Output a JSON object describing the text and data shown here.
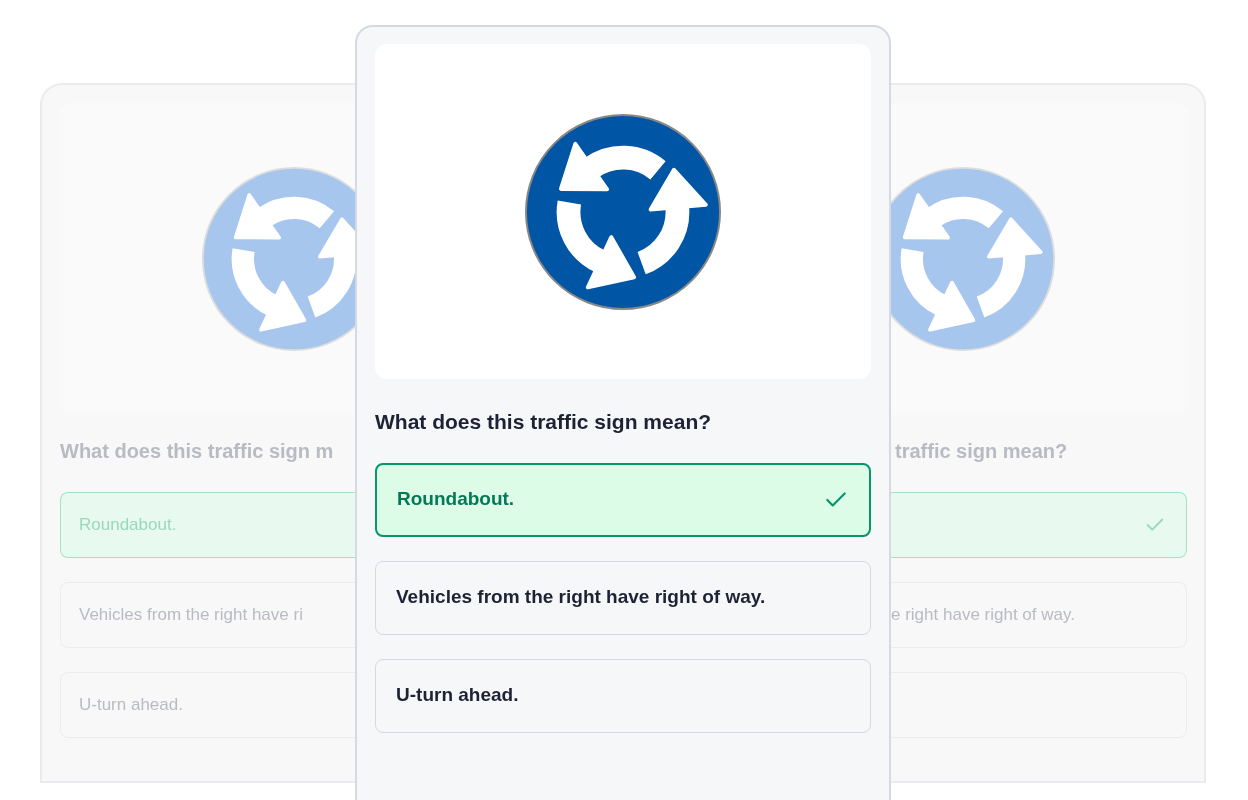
{
  "cards": [
    {
      "kind": "left",
      "question": "What does this traffic sign m",
      "options": [
        {
          "label": "Roundabout.",
          "selected": true
        },
        {
          "label": "Vehicles from the right have ri",
          "selected": false
        },
        {
          "label": "U-turn ahead.",
          "selected": false
        }
      ]
    },
    {
      "kind": "front",
      "question": "What does this traffic sign mean?",
      "options": [
        {
          "label": "Roundabout.",
          "selected": true
        },
        {
          "label": "Vehicles from the right have right of way.",
          "selected": false
        },
        {
          "label": "U-turn ahead.",
          "selected": false
        }
      ]
    },
    {
      "kind": "right",
      "question": "traffic sign mean?",
      "options": [
        {
          "selected": true
        },
        {
          "label": "e right have right of way.",
          "selected": false
        },
        {
          "selected": false
        }
      ]
    }
  ]
}
